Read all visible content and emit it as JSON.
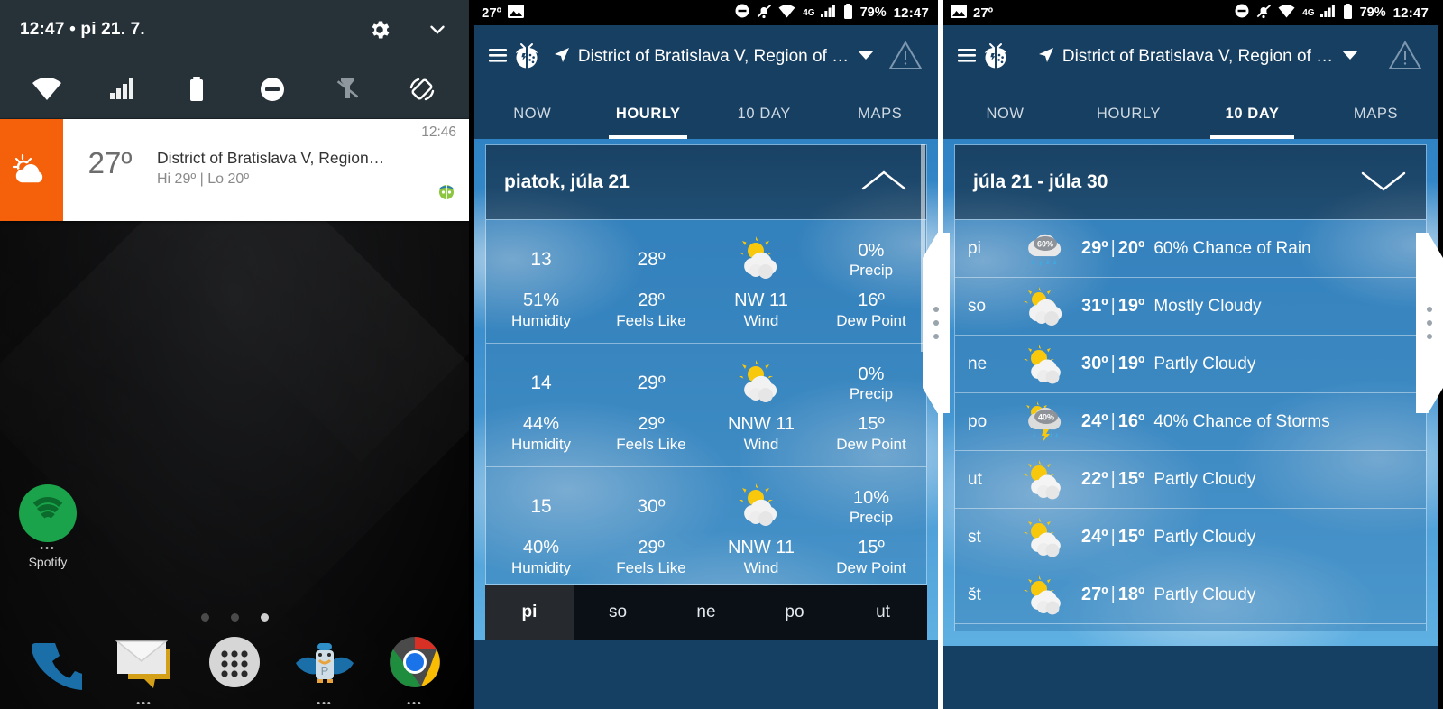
{
  "shade": {
    "status_text": "12:47 • pi 21. 7.",
    "settings_icon": "gear-icon",
    "collapse_icon": "chevron-down-icon",
    "quick_settings": [
      {
        "name": "wifi-icon",
        "label": "Wi-Fi"
      },
      {
        "name": "cellular-signal-icon",
        "label": "Mobile data"
      },
      {
        "name": "battery-icon",
        "label": "Battery"
      },
      {
        "name": "do-not-disturb-icon",
        "label": "Do not disturb"
      },
      {
        "name": "flashlight-off-icon",
        "label": "Flashlight"
      },
      {
        "name": "auto-rotate-icon",
        "label": "Auto rotate"
      }
    ],
    "notification": {
      "temp": "27º",
      "title": "District of Bratislava V, Region…",
      "subtitle": "Hi 29º | Lo 20º",
      "time": "12:46",
      "app_icon": "weatherbug-ladybug-icon",
      "weather_icon": "partly-cloudy-icon"
    }
  },
  "homescreen": {
    "apps": [
      {
        "name": "spotify",
        "label": "Spotify"
      }
    ],
    "page_dots": 3,
    "active_page": 3,
    "dock": [
      {
        "name": "phone",
        "label": "Phone"
      },
      {
        "name": "messaging",
        "label": "Messaging"
      },
      {
        "name": "all-apps",
        "label": "Apps"
      },
      {
        "name": "pushbullet",
        "label": "Pushbullet"
      },
      {
        "name": "chrome",
        "label": "Chrome"
      }
    ]
  },
  "statusbar": {
    "temp": "27º",
    "battery_pct": "79%",
    "clock": "12:47",
    "network": "4G",
    "icons": [
      "photo-icon",
      "do-not-disturb-icon",
      "notifications-off-icon",
      "wifi-icon",
      "cellular-signal-icon",
      "battery-icon"
    ]
  },
  "app": {
    "location": "District of Bratislava V, Region of …",
    "menu_icon": "hamburger-menu-icon",
    "logo_icon": "weatherbug-logo-icon",
    "location_arrow_icon": "navigation-arrow-icon",
    "dropdown_icon": "chevron-down-icon",
    "alert_icon": "warning-triangle-icon",
    "tabs": [
      {
        "label": "NOW",
        "active_hourly": false,
        "active_tenday": false
      },
      {
        "label": "HOURLY",
        "active_hourly": true,
        "active_tenday": false
      },
      {
        "label": "10 DAY",
        "active_hourly": false,
        "active_tenday": true
      },
      {
        "label": "MAPS",
        "active_hourly": false,
        "active_tenday": false
      }
    ]
  },
  "hourly": {
    "card_title": "piatok, júla 21",
    "collapse_icon": "chevron-up-icon",
    "labels": {
      "precip": "Precip",
      "humidity": "Humidity",
      "feels_like": "Feels Like",
      "wind": "Wind",
      "dew_point": "Dew Point"
    },
    "rows": [
      {
        "hour": "13",
        "temp": "28º",
        "icon": "partly-cloudy-icon",
        "precip": "0%",
        "humidity": "51%",
        "feels_like": "28º",
        "wind": "NW 11",
        "dew_point": "16º"
      },
      {
        "hour": "14",
        "temp": "29º",
        "icon": "partly-cloudy-icon",
        "precip": "0%",
        "humidity": "44%",
        "feels_like": "29º",
        "wind": "NNW 11",
        "dew_point": "15º"
      },
      {
        "hour": "15",
        "temp": "30º",
        "icon": "partly-cloudy-icon",
        "precip": "10%",
        "humidity": "40%",
        "feels_like": "29º",
        "wind": "NNW 11",
        "dew_point": "15º"
      }
    ],
    "day_tabs": [
      {
        "label": "pi",
        "active": true
      },
      {
        "label": "so",
        "active": false
      },
      {
        "label": "ne",
        "active": false
      },
      {
        "label": "po",
        "active": false
      },
      {
        "label": "ut",
        "active": false
      }
    ]
  },
  "tenday": {
    "card_title": "júla 21 - júla 30",
    "expand_icon": "chevron-down-icon",
    "rows": [
      {
        "day": "pi",
        "icon": "rain-60-icon",
        "icon_badge": "60%",
        "high": "29º",
        "low": "20º",
        "desc": "60% Chance of Rain"
      },
      {
        "day": "so",
        "icon": "mostly-cloudy-icon",
        "icon_badge": "",
        "high": "31º",
        "low": "19º",
        "desc": "Mostly Cloudy"
      },
      {
        "day": "ne",
        "icon": "partly-cloudy-icon",
        "icon_badge": "",
        "high": "30º",
        "low": "19º",
        "desc": "Partly Cloudy"
      },
      {
        "day": "po",
        "icon": "storms-40-icon",
        "icon_badge": "40%",
        "high": "24º",
        "low": "16º",
        "desc": "40% Chance of Storms"
      },
      {
        "day": "ut",
        "icon": "partly-cloudy-icon",
        "icon_badge": "",
        "high": "22º",
        "low": "15º",
        "desc": "Partly Cloudy"
      },
      {
        "day": "st",
        "icon": "partly-cloudy-icon",
        "icon_badge": "",
        "high": "24º",
        "low": "15º",
        "desc": "Partly Cloudy"
      },
      {
        "day": "št",
        "icon": "partly-cloudy-icon",
        "icon_badge": "",
        "high": "27º",
        "low": "18º",
        "desc": "Partly Cloudy"
      }
    ],
    "separator": "|"
  },
  "colors": {
    "accent_orange": "#f4610a",
    "app_blue": "#173f62",
    "sky_blue": "#3d90cd",
    "shade_gray": "#263238"
  }
}
